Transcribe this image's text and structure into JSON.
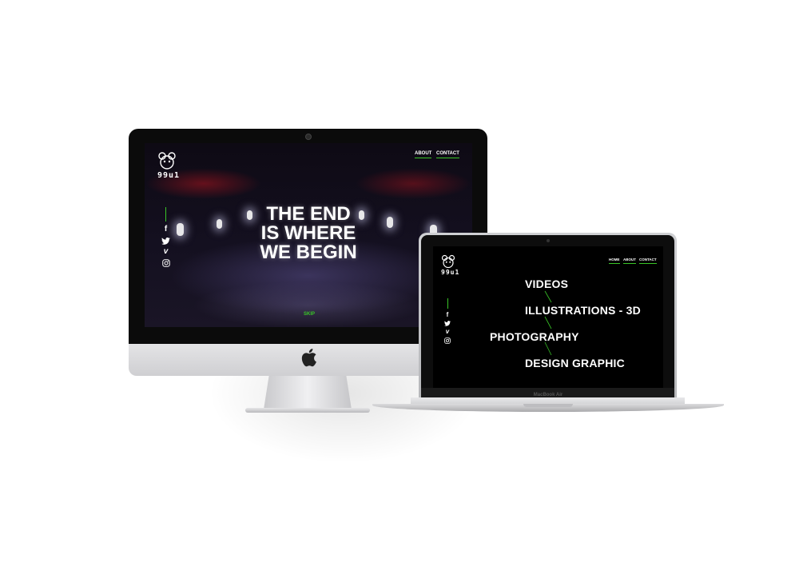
{
  "imac": {
    "nav": {
      "about": "ABOUT",
      "contact": "CONTACT"
    },
    "brand_text": "99u1",
    "hero_lines": [
      "THE END",
      "IS WHERE",
      "WE BEGIN"
    ],
    "skip_label": "SKIP",
    "social_icons": [
      "facebook-icon",
      "twitter-icon",
      "vimeo-icon",
      "instagram-icon"
    ]
  },
  "macbook": {
    "nav": {
      "home": "HOME",
      "about": "ABOUT",
      "contact": "CONTACT"
    },
    "brand_text": "99u1",
    "menu": [
      "VIDEOS",
      "ILLUSTRATIONS - 3D",
      "PHOTOGRAPHY",
      "DESIGN GRAPHIC"
    ],
    "device_label": "MacBook Air",
    "social_icons": [
      "facebook-icon",
      "twitter-icon",
      "vimeo-icon",
      "instagram-icon"
    ]
  },
  "colors": {
    "accent": "#39c527",
    "screen_bg": "#000000",
    "text": "#ffffff"
  }
}
